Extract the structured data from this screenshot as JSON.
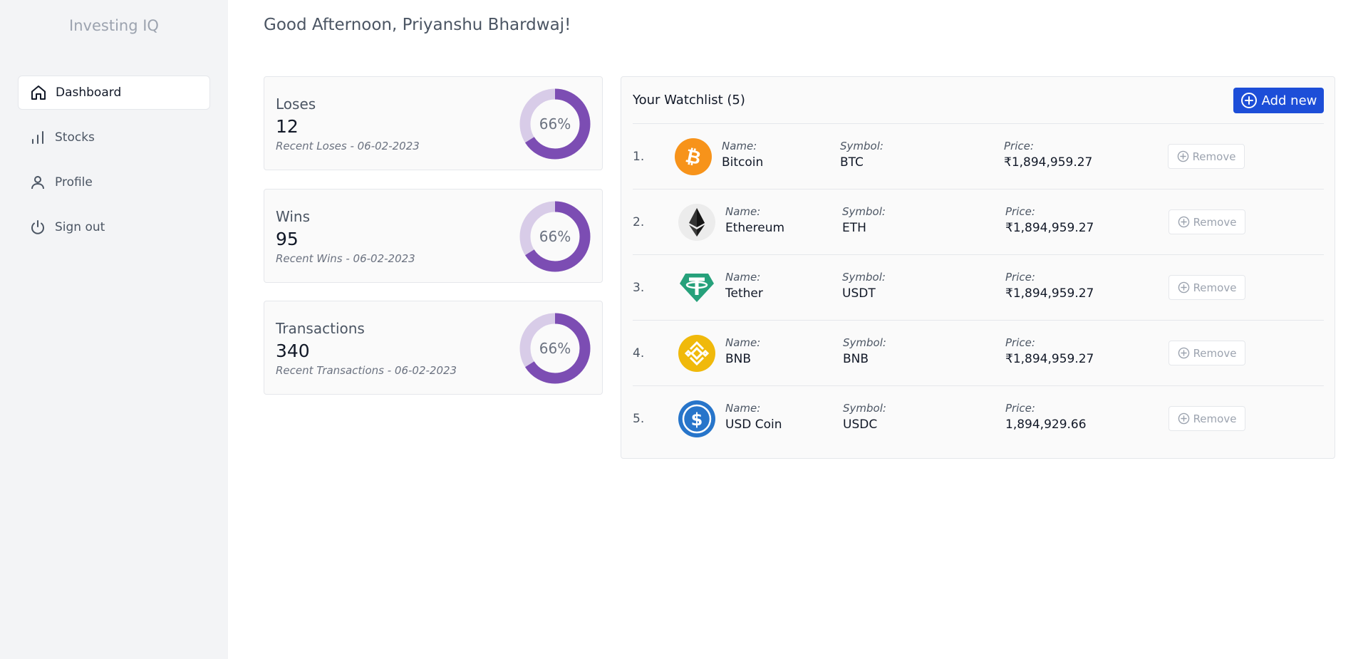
{
  "app": {
    "brand": "Investing IQ"
  },
  "sidebar": {
    "items": [
      {
        "label": "Dashboard",
        "icon": "home-icon",
        "active": true
      },
      {
        "label": "Stocks",
        "icon": "bar-chart-icon",
        "active": false
      },
      {
        "label": "Profile",
        "icon": "user-icon",
        "active": false
      },
      {
        "label": "Sign out",
        "icon": "power-icon",
        "active": false
      }
    ]
  },
  "header": {
    "greeting": "Good Afternoon, Priyanshu Bhardwaj!"
  },
  "stats": [
    {
      "title": "Loses",
      "value": "12",
      "subtitle": "Recent Loses - 06-02-2023",
      "percent_label": "66%",
      "percent": 66
    },
    {
      "title": "Wins",
      "value": "95",
      "subtitle": "Recent Wins - 06-02-2023",
      "percent_label": "66%",
      "percent": 66
    },
    {
      "title": "Transactions",
      "value": "340",
      "subtitle": "Recent Transactions - 06-02-2023",
      "percent_label": "66%",
      "percent": 66
    }
  ],
  "colors": {
    "donut_fill": "#7c4db3",
    "donut_track": "#d8cce8",
    "accent": "#1d4ed8"
  },
  "watchlist": {
    "title": "Your Watchlist (5)",
    "add_label": "Add new",
    "labels": {
      "name": "Name:",
      "symbol": "Symbol:",
      "price": "Price:"
    },
    "remove_label": "Remove",
    "items": [
      {
        "index": "1.",
        "name": "Bitcoin",
        "symbol": "BTC",
        "price": "₹1,894,959.27",
        "icon": "bitcoin-icon"
      },
      {
        "index": "2.",
        "name": "Ethereum",
        "symbol": "ETH",
        "price": "₹1,894,959.27",
        "icon": "ethereum-icon"
      },
      {
        "index": "3.",
        "name": "Tether",
        "symbol": "USDT",
        "price": "₹1,894,959.27",
        "icon": "tether-icon"
      },
      {
        "index": "4.",
        "name": "BNB",
        "symbol": "BNB",
        "price": "₹1,894,959.27",
        "icon": "bnb-icon"
      },
      {
        "index": "5.",
        "name": "USD Coin",
        "symbol": "USDC",
        "price": "1,894,929.66",
        "icon": "usd-coin-icon"
      }
    ]
  }
}
